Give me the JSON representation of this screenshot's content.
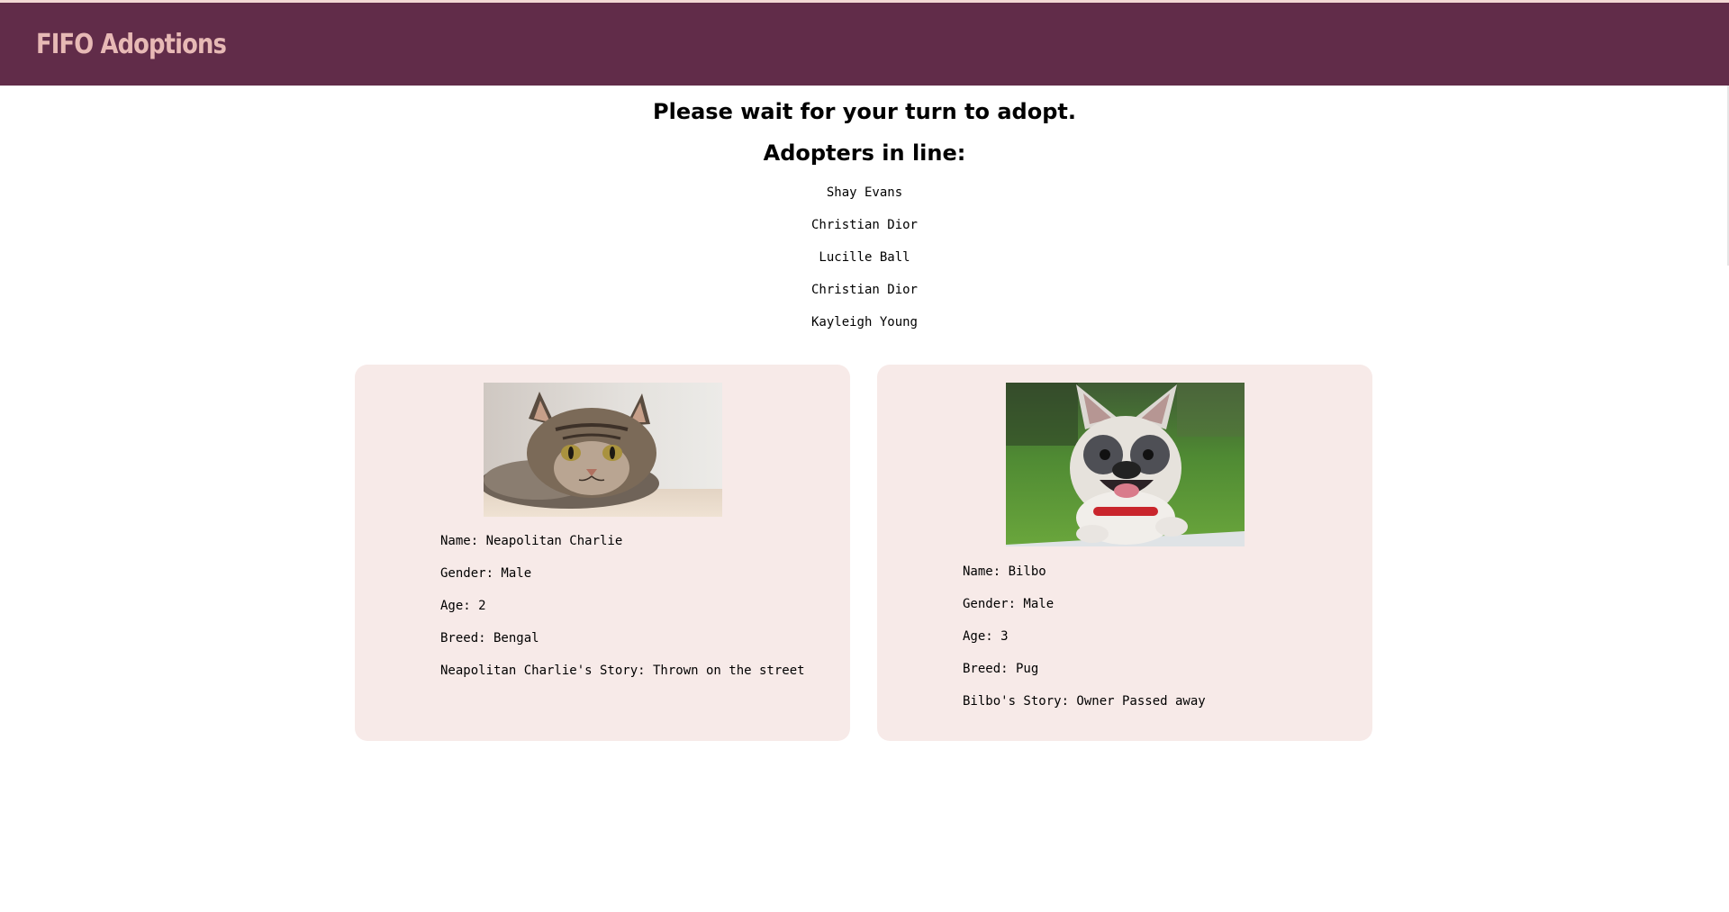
{
  "header": {
    "brand": "FIFO Adoptions"
  },
  "queue": {
    "wait_message": "Please wait for your turn to adopt.",
    "heading": "Adopters in line:",
    "adopters": [
      "Shay Evans",
      "Christian Dior",
      "Lucille Ball",
      "Christian Dior",
      "Kayleigh Young"
    ]
  },
  "pets": [
    {
      "image": "tabby-cat-photo",
      "name_line": "Name: Neapolitan Charlie",
      "gender_line": "Gender: Male",
      "age_line": "Age: 2",
      "breed_line": "Breed: Bengal",
      "story_line": "Neapolitan Charlie's Story: Thrown on the street"
    },
    {
      "image": "french-bulldog-photo",
      "name_line": "Name: Bilbo",
      "gender_line": "Gender: Male",
      "age_line": "Age: 3",
      "breed_line": "Breed: Pug",
      "story_line": "Bilbo's Story: Owner Passed away"
    }
  ],
  "colors": {
    "header_bg": "#612c49",
    "brand_text": "#e7b9b5",
    "card_bg": "#f7eae8"
  }
}
